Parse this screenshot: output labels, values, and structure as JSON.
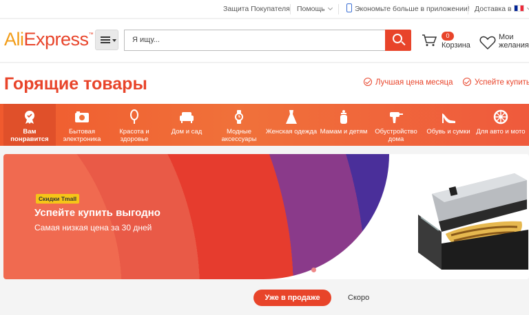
{
  "topbar": {
    "buyer_protection": "Защита Покупателя",
    "help": "Помощь",
    "app_promo": "Экономьте больше в приложении!",
    "delivery": "Доставка в"
  },
  "header": {
    "logo_ali": "Ali",
    "logo_express": "Express",
    "logo_mark": "™",
    "search_placeholder": "Я ищу...",
    "cart_count": "0",
    "cart_label": "Корзина",
    "wishlist_label": "Мои желания"
  },
  "page": {
    "title": "Горящие товары",
    "promo_best_price": "Лучшая цена месяца",
    "promo_hurry": "Успейте купить"
  },
  "categories": [
    {
      "label": "Вам понравится",
      "icon": "award-icon"
    },
    {
      "label": "Бытовая электроника",
      "icon": "camera-icon"
    },
    {
      "label": "Красота и здоровье",
      "icon": "mirror-icon"
    },
    {
      "label": "Дом и сад",
      "icon": "sofa-icon"
    },
    {
      "label": "Модные аксессуары",
      "icon": "watch-icon"
    },
    {
      "label": "Женская одежда",
      "icon": "dress-icon"
    },
    {
      "label": "Мамам и детям",
      "icon": "baby-bottle-icon"
    },
    {
      "label": "Обустройство дома",
      "icon": "drill-icon"
    },
    {
      "label": "Обувь и сумки",
      "icon": "heel-shoe-icon"
    },
    {
      "label": "Для авто и мото",
      "icon": "wheel-icon"
    }
  ],
  "banner": {
    "tag": "Скидки Tmall",
    "title": "Успейте купить выгодно",
    "subtitle": "Самая низкая цена за 30 дней",
    "slide_count": 2,
    "active_slide": 2
  },
  "tabs": {
    "on_sale": "Уже в продаже",
    "soon": "Скоро"
  },
  "colors": {
    "accent": "#e8442a",
    "logo_orange": "#f29d19",
    "category_bar": "#f0713a"
  }
}
